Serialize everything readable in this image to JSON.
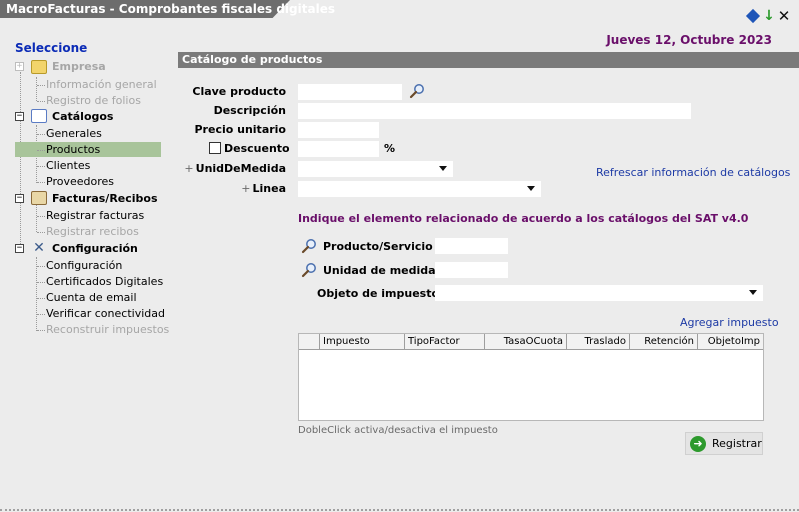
{
  "window": {
    "title": "MacroFacturas - Comprobantes fiscales digitales"
  },
  "header": {
    "date": "Jueves 12, Octubre 2023"
  },
  "sidebar": {
    "heading": "Seleccione",
    "groups": [
      {
        "label": "Empresa",
        "toggle": "+",
        "enabled": false,
        "icon": "folder-icon",
        "items": [
          {
            "label": "Información general",
            "enabled": false
          },
          {
            "label": "Registro de folios",
            "enabled": false
          }
        ]
      },
      {
        "label": "Catálogos",
        "toggle": "−",
        "enabled": true,
        "icon": "document-icon",
        "items": [
          {
            "label": "Generales",
            "enabled": true
          },
          {
            "label": "Productos",
            "enabled": true,
            "selected": true
          },
          {
            "label": "Clientes",
            "enabled": true
          },
          {
            "label": "Proveedores",
            "enabled": true
          }
        ]
      },
      {
        "label": "Facturas/Recibos",
        "toggle": "−",
        "enabled": true,
        "icon": "contact-card-icon",
        "items": [
          {
            "label": "Registrar facturas",
            "enabled": true
          },
          {
            "label": "Registrar recibos",
            "enabled": false
          }
        ]
      },
      {
        "label": "Configuración",
        "toggle": "−",
        "enabled": true,
        "icon": "tools-icon",
        "items": [
          {
            "label": "Configuración",
            "enabled": true
          },
          {
            "label": "Certificados Digitales",
            "enabled": true
          },
          {
            "label": "Cuenta de email",
            "enabled": true
          },
          {
            "label": "Verificar conectividad",
            "enabled": true
          },
          {
            "label": "Reconstruir impuestos",
            "enabled": false
          }
        ]
      }
    ]
  },
  "panel": {
    "title": "Catálogo de productos",
    "fields": {
      "clave_label": "Clave producto",
      "clave_value": "",
      "descripcion_label": "Descripción",
      "descripcion_value": "",
      "precio_label": "Precio unitario",
      "precio_value": "",
      "descuento_label": "Descuento",
      "descuento_checked": false,
      "descuento_value": "",
      "descuento_unit": "%",
      "unidad_label": "UnidDeMedida",
      "unidad_value": "",
      "linea_label": "Linea",
      "linea_value": "",
      "plus": "+"
    },
    "refresh_link": "Refrescar información de catálogos",
    "sat": {
      "heading": "Indique el elemento relacionado de acuerdo a los catálogos del SAT v4.0",
      "producto_label": "Producto/Servicio",
      "producto_value": "",
      "unidad_label": "Unidad de medida",
      "unidad_value": "",
      "objeto_label": "Objeto de impuesto",
      "objeto_value": ""
    },
    "add_tax_link": "Agregar impuesto",
    "tax_table": {
      "columns": [
        "Impuesto",
        "TipoFactor",
        "TasaOCuota",
        "Traslado",
        "Retención",
        "ObjetoImp"
      ],
      "rows": []
    },
    "hint": "DobleClick activa/desactiva el impuesto",
    "register_button": "Registrar"
  },
  "colors": {
    "title_bg": "#6d6d6d",
    "date": "#6a0f6a",
    "sidebar_heading": "#0b2bb6",
    "selected_bg": "#a8c49a",
    "panel_header_bg": "#7a7a7a",
    "link": "#1d3aa5"
  }
}
